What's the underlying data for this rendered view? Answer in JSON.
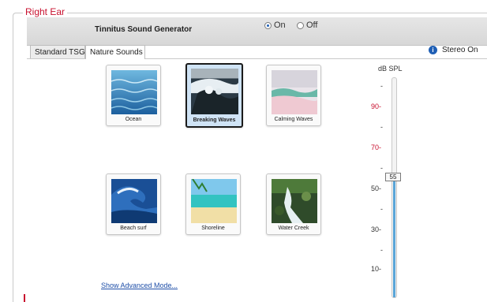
{
  "panel": {
    "legend": "Right Ear"
  },
  "header": {
    "title": "Tinnitus Sound Generator",
    "on_label": "On",
    "off_label": "Off",
    "selected": "On"
  },
  "tabs": [
    {
      "label": "Standard TSG",
      "active": false
    },
    {
      "label": "Nature Sounds",
      "active": true
    }
  ],
  "stereo": {
    "label": "Stereo On",
    "icon": "info-icon"
  },
  "sounds": [
    {
      "label": "Ocean",
      "selected": false
    },
    {
      "label": "Breaking Waves",
      "selected": true
    },
    {
      "label": "Calming Waves",
      "selected": false
    },
    {
      "label": "Beach surf",
      "selected": false
    },
    {
      "label": "Shoreline",
      "selected": false
    },
    {
      "label": "Water Creek",
      "selected": false
    }
  ],
  "advanced_link": "Show Advanced Mode...",
  "level": {
    "unit": "dB SPL",
    "value": "55",
    "ticks": [
      "90",
      "70",
      "50",
      "30",
      "10"
    ],
    "highlight_color": "#c8102e"
  }
}
